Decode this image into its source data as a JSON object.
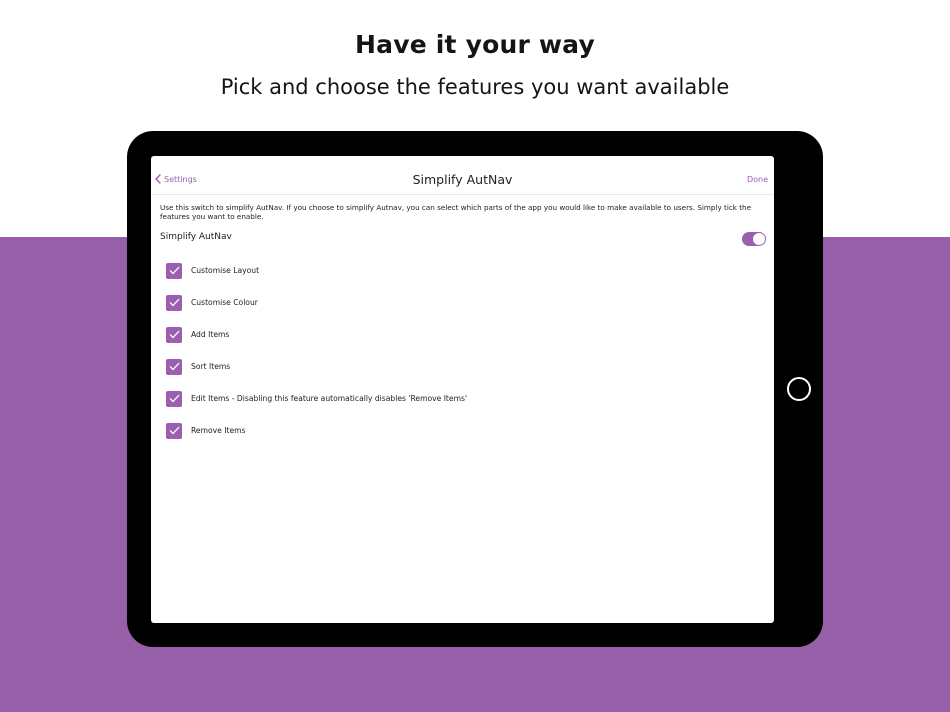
{
  "promo": {
    "headline": "Have it your way",
    "subheadline": "Pick and choose the features you want available"
  },
  "colors": {
    "accent": "#9b5fb0",
    "background_band": "#965fa8"
  },
  "navbar": {
    "back_label": "Settings",
    "title": "Simplify AutNav",
    "done_label": "Done"
  },
  "description": "Use this switch to simplify AutNav. If you choose to simplify Autnav, you can select which parts of the app you would like to make available to users. Simply tick the features you want to enable.",
  "simplify": {
    "label": "Simplify AutNav",
    "enabled": true
  },
  "features": [
    {
      "label": "Customise Layout",
      "checked": true
    },
    {
      "label": "Customise Colour",
      "checked": true
    },
    {
      "label": "Add Items",
      "checked": true
    },
    {
      "label": "Sort Items",
      "checked": true
    },
    {
      "label": "Edit Items - Disabling this feature automatically disables 'Remove Items'",
      "checked": true
    },
    {
      "label": "Remove Items",
      "checked": true
    }
  ]
}
